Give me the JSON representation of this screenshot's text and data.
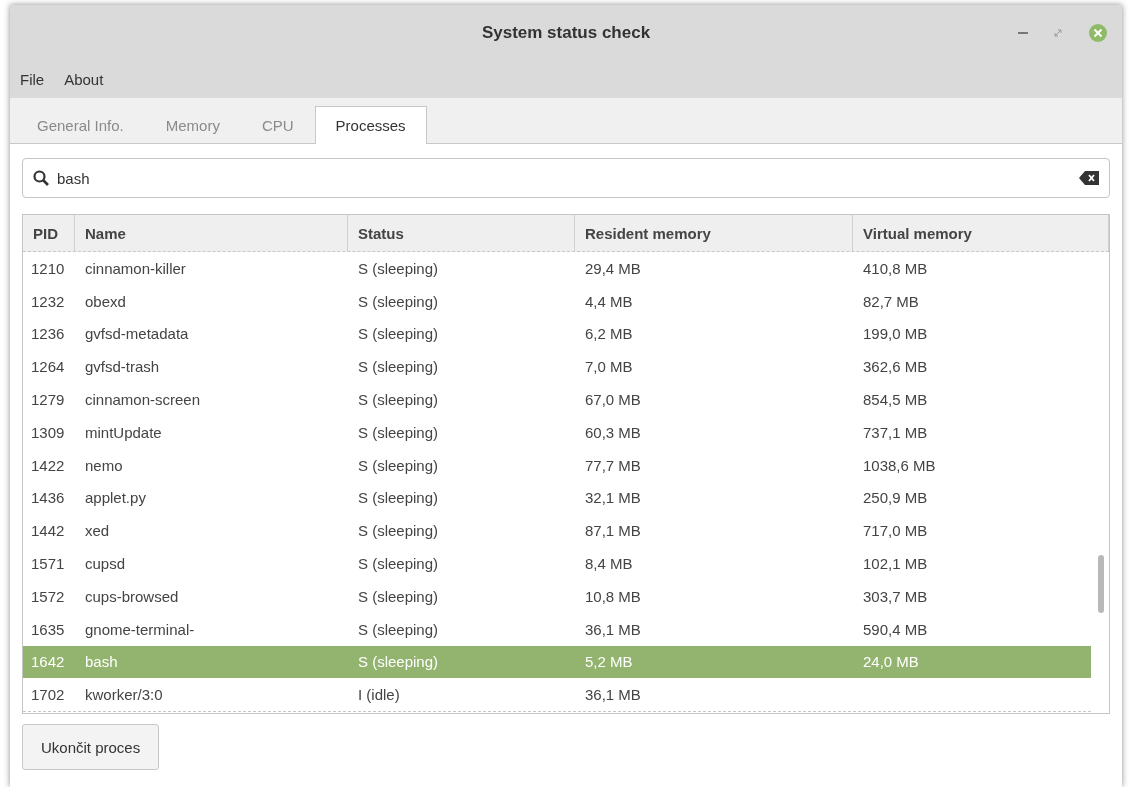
{
  "window": {
    "title": "System status check"
  },
  "menu": [
    "File",
    "About"
  ],
  "tabs": [
    {
      "label": "General Info.",
      "selected": false
    },
    {
      "label": "Memory",
      "selected": false
    },
    {
      "label": "CPU",
      "selected": false
    },
    {
      "label": "Processes",
      "selected": true
    }
  ],
  "search": {
    "value": "bash"
  },
  "table": {
    "columns": [
      "PID",
      "Name",
      "Status",
      "Resident memory",
      "Virtual memory"
    ],
    "rows": [
      {
        "cells": [
          "1210",
          "cinnamon-killer",
          "S (sleeping)",
          "29,4 MB",
          "410,8 MB"
        ],
        "selected": false
      },
      {
        "cells": [
          "1232",
          "obexd",
          "S (sleeping)",
          "4,4 MB",
          "82,7 MB"
        ],
        "selected": false
      },
      {
        "cells": [
          "1236",
          "gvfsd-metadata",
          "S (sleeping)",
          "6,2 MB",
          "199,0 MB"
        ],
        "selected": false
      },
      {
        "cells": [
          "1264",
          "gvfsd-trash",
          "S (sleeping)",
          "7,0 MB",
          "362,6 MB"
        ],
        "selected": false
      },
      {
        "cells": [
          "1279",
          "cinnamon-screen",
          "S (sleeping)",
          "67,0 MB",
          "854,5 MB"
        ],
        "selected": false
      },
      {
        "cells": [
          "1309",
          "mintUpdate",
          "S (sleeping)",
          "60,3 MB",
          "737,1 MB"
        ],
        "selected": false
      },
      {
        "cells": [
          "1422",
          "nemo",
          "S (sleeping)",
          "77,7 MB",
          "1038,6 MB"
        ],
        "selected": false
      },
      {
        "cells": [
          "1436",
          "applet.py",
          "S (sleeping)",
          "32,1 MB",
          "250,9 MB"
        ],
        "selected": false
      },
      {
        "cells": [
          "1442",
          "xed",
          "S (sleeping)",
          "87,1 MB",
          "717,0 MB"
        ],
        "selected": false
      },
      {
        "cells": [
          "1571",
          "cupsd",
          "S (sleeping)",
          "8,4 MB",
          "102,1 MB"
        ],
        "selected": false
      },
      {
        "cells": [
          "1572",
          "cups-browsed",
          "S (sleeping)",
          "10,8 MB",
          "303,7 MB"
        ],
        "selected": false
      },
      {
        "cells": [
          "1635",
          "gnome-terminal-",
          "S (sleeping)",
          "36,1 MB",
          "590,4 MB"
        ],
        "selected": false
      },
      {
        "cells": [
          "1642",
          "bash",
          "S (sleeping)",
          "5,2 MB",
          "24,0 MB"
        ],
        "selected": true
      },
      {
        "cells": [
          "1702",
          "kworker/3:0",
          "I (idle)",
          "36,1 MB"
        ],
        "selected": false
      }
    ]
  },
  "button": "Ukončit proces"
}
